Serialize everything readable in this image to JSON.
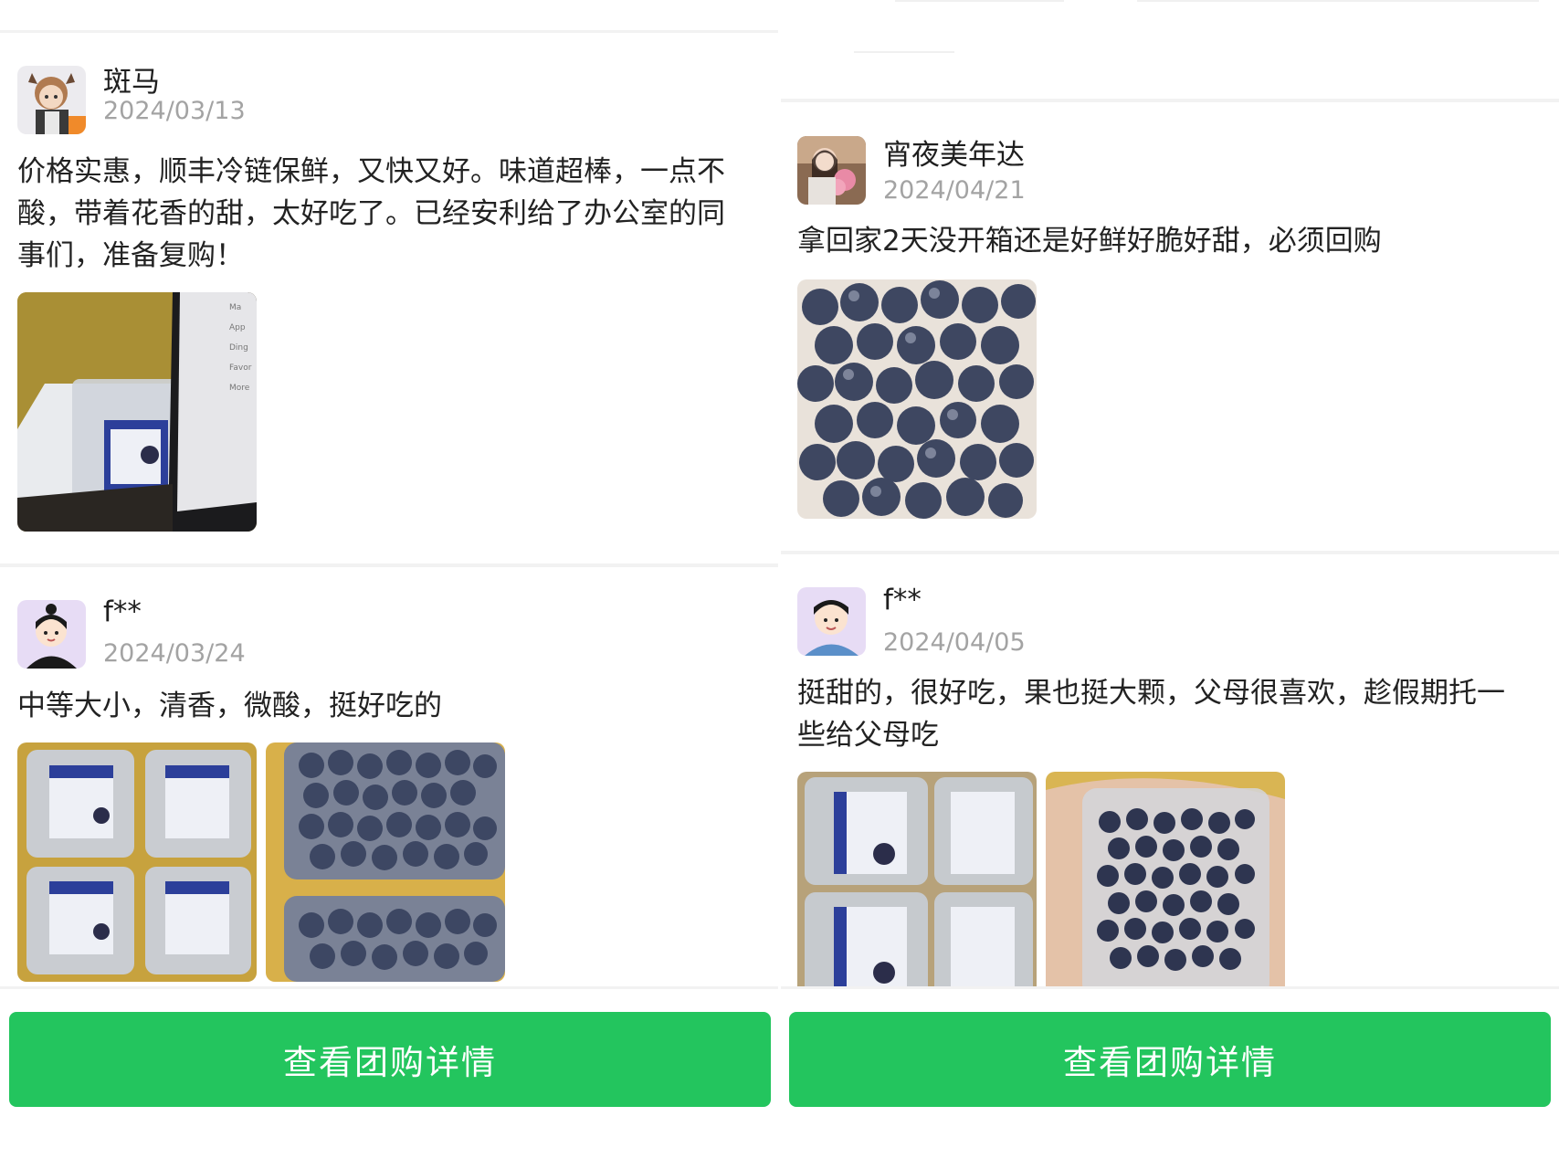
{
  "colors": {
    "accent_green": "#23c55e",
    "date_gray": "#a3a3a3",
    "text": "#222222"
  },
  "left_panel": {
    "reviews": [
      {
        "user": "斑马",
        "date": "2024/03/13",
        "text": "价格实惠，顺丰冷链保鲜，又快又好。味道超棒，一点不酸，带着花香的甜，太好吃了。已经安利给了办公室的同事们，准备复购！",
        "photo_menu": [
          "Ma",
          "App",
          "Ding",
          "Favor",
          "More"
        ]
      },
      {
        "user": "f**",
        "date": "2024/03/24",
        "text": "中等大小，清香，微酸，挺好吃的"
      }
    ],
    "button_label": "查看团购详情"
  },
  "right_panel": {
    "reviews": [
      {
        "user": "宵夜美年达",
        "date": "2024/04/21",
        "text": "拿回家2天没开箱还是好鲜好脆好甜，必须回购"
      },
      {
        "user": "f**",
        "date": "2024/04/05",
        "text": "挺甜的，很好吃，果也挺大颗，父母很喜欢，趁假期托一些给父母吃"
      }
    ],
    "button_label": "查看团购详情"
  }
}
